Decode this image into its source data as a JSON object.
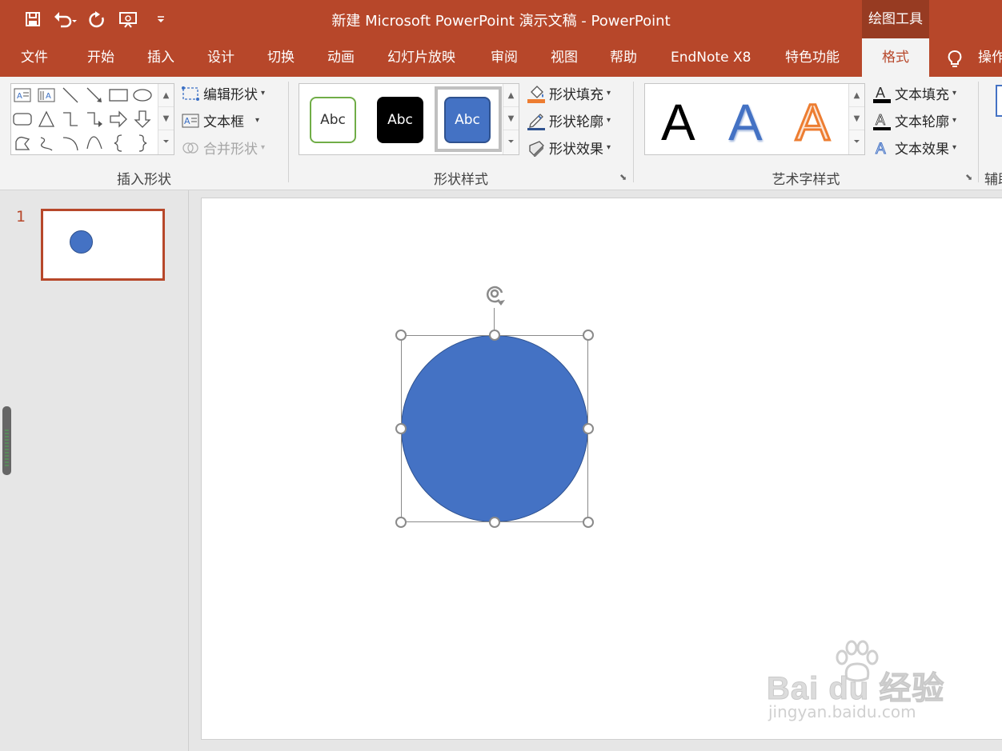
{
  "titlebar": {
    "title": "新建 Microsoft PowerPoint 演示文稿  -  PowerPoint",
    "context_group": "绘图工具",
    "qat_icons": [
      "save-icon",
      "undo-icon",
      "redo-icon",
      "slideshow-icon",
      "customize-icon"
    ]
  },
  "tabs": [
    "文件",
    "开始",
    "插入",
    "设计",
    "切换",
    "动画",
    "幻灯片放映",
    "审阅",
    "视图",
    "帮助",
    "EndNote X8",
    "特色功能",
    "格式",
    "操作"
  ],
  "active_tab": "格式",
  "ribbon": {
    "insert_shapes": {
      "label": "插入形状",
      "edit_shape": "编辑形状",
      "text_box": "文本框",
      "merge_shapes": "合并形状"
    },
    "shape_styles": {
      "label": "形状样式",
      "swatch_text": "Abc",
      "fill": "形状填充",
      "outline": "形状轮廓",
      "effects": "形状效果"
    },
    "wordart_styles": {
      "label": "艺术字样式",
      "letter": "A",
      "text_fill": "文本填充",
      "text_outline": "文本轮廓",
      "text_effects": "文本效果"
    },
    "accessibility": {
      "label": "辅助"
    }
  },
  "thumbnails": {
    "slide_number": "1"
  },
  "colors": {
    "accent": "#b7472a",
    "shape_fill": "#4472c4",
    "shape_border": "#2f528f",
    "wordart_orange": "#ed7d31"
  },
  "watermark": {
    "brand": "Bai du 经验",
    "url": "jingyan.baidu.com"
  }
}
